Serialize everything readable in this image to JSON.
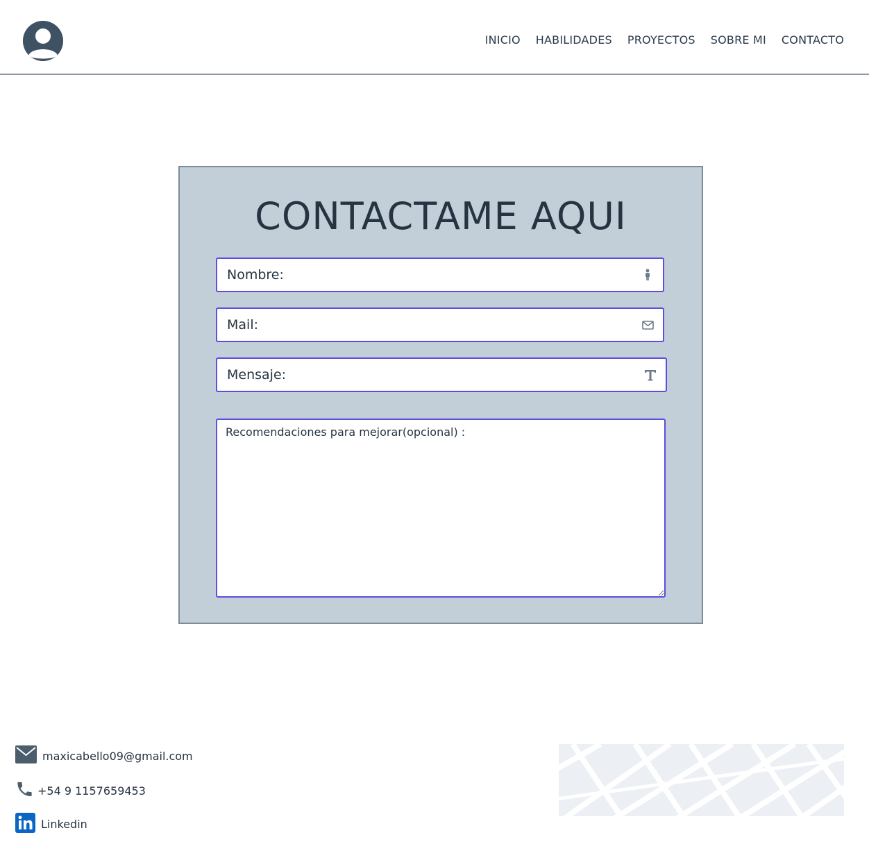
{
  "header": {
    "avatar_icon": "user-avatar-icon",
    "nav": [
      {
        "label": "INICIO"
      },
      {
        "label": "HABILIDADES"
      },
      {
        "label": "PROYECTOS"
      },
      {
        "label": "SOBRE MI"
      },
      {
        "label": "CONTACTO"
      }
    ]
  },
  "form": {
    "title": "CONTACTAME AQUI",
    "nombre": {
      "placeholder": "Nombre:",
      "value": "",
      "icon": "person-icon"
    },
    "mail": {
      "placeholder": "Mail:",
      "value": "",
      "icon": "envelope-icon"
    },
    "mensaje": {
      "placeholder": "Mensaje:",
      "value": "",
      "icon": "text-icon"
    },
    "recomendaciones": {
      "placeholder": "Recomendaciones para mejorar(opcional) :",
      "value": ""
    }
  },
  "footer": {
    "email": {
      "icon": "mail-icon",
      "text": "maxicabello09@gmail.com"
    },
    "phone": {
      "icon": "phone-icon",
      "text": "+54 9 1157659453"
    },
    "linkedin": {
      "icon": "linkedin-icon",
      "text": "Linkedin"
    },
    "map": {
      "icon": "map-pattern"
    }
  },
  "colors": {
    "card_bg": "#c2cfd9",
    "field_border": "#5b4ee0",
    "text": "#263341",
    "icon_gray": "#6d7b89",
    "linkedin_blue": "#0a66c2"
  }
}
